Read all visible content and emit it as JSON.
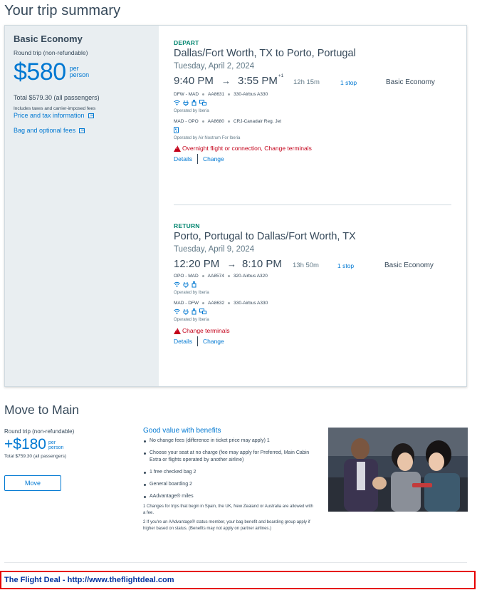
{
  "page_title": "Your trip summary",
  "fare": {
    "name": "Basic Economy",
    "trip_type": "Round trip (non-refundable)",
    "price": "$580",
    "per_label": "per person",
    "total": "Total $579.30 (all passengers)",
    "taxes_note": "Includes taxes and carrier-imposed fees",
    "price_tax_link": "Price and tax information",
    "bag_fees_link": "Bag and optional fees"
  },
  "depart": {
    "tag": "DEPART",
    "route": "Dallas/Fort Worth, TX to Porto, Portugal",
    "date": "Tuesday, April 2, 2024",
    "dep_time": "9:40 PM",
    "arrow": "→",
    "arr_time": "3:55 PM",
    "plus_day": "+1",
    "duration": "12h 15m",
    "stops": "1 stop",
    "cabin": "Basic Economy",
    "segments": [
      {
        "route": "DFW - MAD",
        "flight": "AA8631",
        "aircraft": "330-Airbus A330",
        "amenities": [
          "wifi-icon",
          "power-icon",
          "usb-icon",
          "entertainment-icon"
        ],
        "operated_by": "Operated by Iberia"
      },
      {
        "route": "MAD - OPO",
        "flight": "AA8680",
        "aircraft": "CRJ-Canadair Reg. Jet",
        "amenities": [
          "power-outlet-icon"
        ],
        "operated_by": "Operated by Air Nostrum For Iberia"
      }
    ],
    "warning": "Overnight flight or connection, Change terminals",
    "details_link": "Details",
    "change_link": "Change"
  },
  "return": {
    "tag": "RETURN",
    "route": "Porto, Portugal to Dallas/Fort Worth, TX",
    "date": "Tuesday, April 9, 2024",
    "dep_time": "12:20 PM",
    "arrow": "→",
    "arr_time": "8:10 PM",
    "duration": "13h 50m",
    "stops": "1 stop",
    "cabin": "Basic Economy",
    "segments": [
      {
        "route": "OPO - MAD",
        "flight": "AA8574",
        "aircraft": "320-Airbus A320",
        "amenities": [
          "wifi-icon",
          "power-icon",
          "usb-icon"
        ],
        "operated_by": "Operated by Iberia"
      },
      {
        "route": "MAD - DFW",
        "flight": "AA8632",
        "aircraft": "330-Airbus A330",
        "amenities": [
          "wifi-icon",
          "power-icon",
          "usb-icon",
          "entertainment-icon"
        ],
        "operated_by": "Operated by Iberia"
      }
    ],
    "warning": "Change terminals",
    "details_link": "Details",
    "change_link": "Change"
  },
  "move_to_main": {
    "title": "Move to Main",
    "trip_type": "Round trip (non-refundable)",
    "price": "+$180",
    "per_label": "per person",
    "total": "Total $759.30 (all passengers)",
    "button_label": "Move",
    "benefits_title": "Good value with benefits",
    "benefits": [
      "No change fees (difference in ticket price may apply) 1",
      "Choose your seat at no charge (fee may apply for Preferred, Main Cabin Extra or flights operated by another airline)",
      "1 free checked bag 2",
      "General boarding 2",
      "AAdvantage® miles"
    ],
    "footnotes": [
      "1 Changes for trips that begin in Spain, the UK, New Zealand or Australia are allowed with a fee.",
      "2 If you're an AAdvantage® status member, your bag benefit and boarding group apply if higher based on status. (Benefits may not apply on partner airlines.)"
    ]
  },
  "banner": {
    "text": "The Flight Deal - http://www.theflightdeal.com"
  },
  "colors": {
    "link_blue": "#0078d2",
    "depart_green": "#00856f",
    "warning_red": "#c30019",
    "banner_red": "#e60000",
    "banner_text": "#0033a0"
  }
}
